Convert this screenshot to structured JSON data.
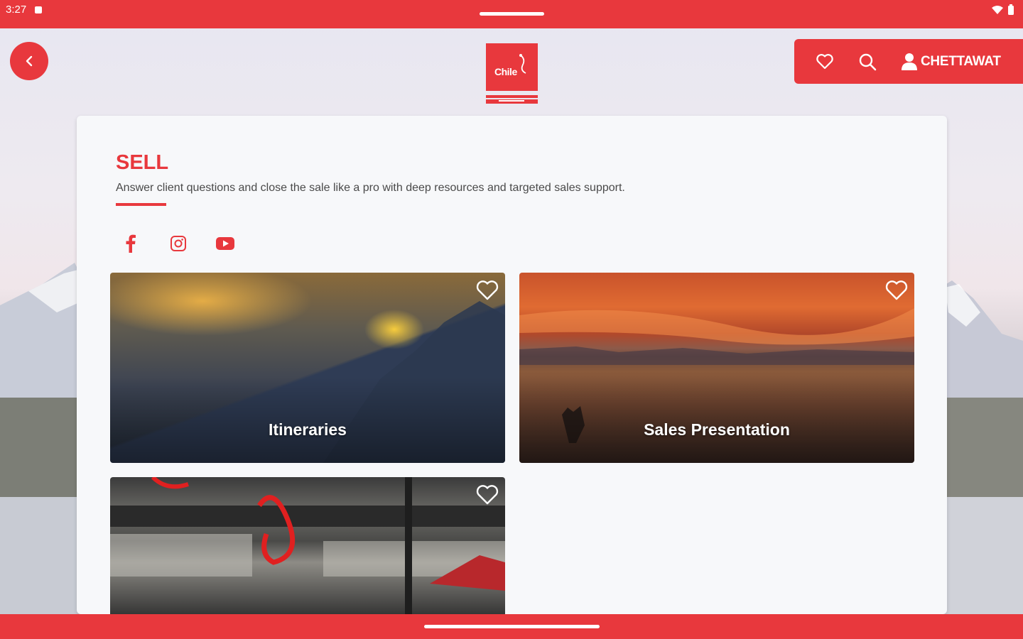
{
  "status_bar": {
    "time": "3:27"
  },
  "header": {
    "logo_text": "Chile",
    "user_name": "CHETTAWAT"
  },
  "section": {
    "title": "SELL",
    "description": "Answer client questions and close the sale like a pro with deep resources and targeted sales support."
  },
  "social": [
    "facebook-icon",
    "instagram-icon",
    "youtube-icon"
  ],
  "tiles": [
    {
      "label": "Itineraries"
    },
    {
      "label": "Sales Presentation"
    },
    {
      "label": ""
    }
  ],
  "colors": {
    "accent": "#e8383d",
    "card_bg": "#f7f8fa"
  }
}
